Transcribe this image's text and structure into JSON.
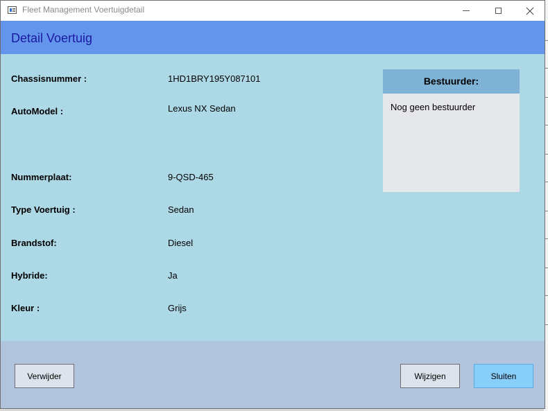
{
  "window": {
    "title": "Fleet Management Voertuigdetail"
  },
  "header": {
    "title": "Detail Voertuig"
  },
  "fields": [
    {
      "label": "Chassisnummer :",
      "value": "1HD1BRY195Y087101"
    },
    {
      "label": "AutoModel :",
      "value": "Lexus NX Sedan"
    },
    {
      "label": "Nummerplaat:",
      "value": "9-QSD-465"
    },
    {
      "label": "Type Voertuig :",
      "value": "Sedan"
    },
    {
      "label": "Brandstof:",
      "value": "Diesel"
    },
    {
      "label": "Hybride:",
      "value": "Ja"
    },
    {
      "label": "Kleur :",
      "value": "Grijs"
    }
  ],
  "driver": {
    "header": "Bestuurder:",
    "text": "Nog geen bestuurder"
  },
  "buttons": {
    "delete_label": "Verwijder",
    "edit_label": "Wijzigen",
    "close_label": "Sluiten"
  },
  "colors": {
    "header_bg": "#6495ed",
    "content_bg": "#add8e6",
    "footer_bg": "#b0c4de",
    "driver_header_bg": "#7fb3d5",
    "primary_button_bg": "#87cefa"
  },
  "icons": {
    "app": "app-window-icon",
    "minimize": "minimize-icon",
    "maximize": "maximize-icon",
    "close": "close-icon"
  }
}
